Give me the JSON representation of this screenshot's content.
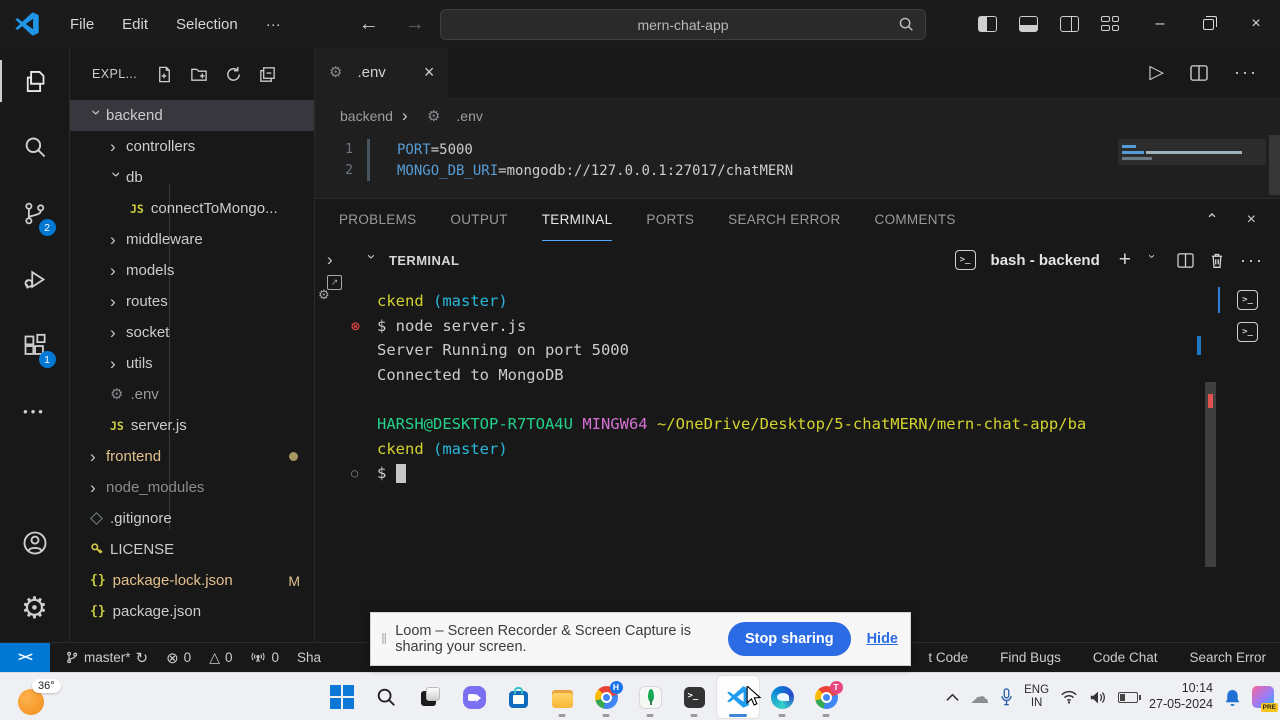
{
  "colors": {
    "accent": "#0078d4",
    "modified": "#e2c08d",
    "ignored": "#8c8c8c",
    "error_red": "#f14c4c"
  },
  "titlebar": {
    "menus": [
      "File",
      "Edit",
      "Selection",
      "···"
    ],
    "search": "mern-chat-app"
  },
  "activitybar": {
    "scm_badge": "2",
    "extensions_badge": "1"
  },
  "sidebar": {
    "header": "EXPL...",
    "tree": [
      {
        "label": "backend",
        "level": 0,
        "chevron": "down",
        "selected": true
      },
      {
        "label": "controllers",
        "level": 1,
        "chevron": "right"
      },
      {
        "label": "db",
        "level": 1,
        "chevron": "down"
      },
      {
        "label": "connectToMongo...",
        "level": 2,
        "icon": "js"
      },
      {
        "label": "middleware",
        "level": 1,
        "chevron": "right"
      },
      {
        "label": "models",
        "level": 1,
        "chevron": "right"
      },
      {
        "label": "routes",
        "level": 1,
        "chevron": "right"
      },
      {
        "label": "socket",
        "level": 1,
        "chevron": "right"
      },
      {
        "label": "utils",
        "level": 1,
        "chevron": "right"
      },
      {
        "label": ".env",
        "level": 1,
        "icon": "gear",
        "color": "#9b9b9b"
      },
      {
        "label": "server.js",
        "level": 1,
        "icon": "js"
      },
      {
        "label": "frontend",
        "level": 0,
        "chevron": "right",
        "color": "#e2c08d",
        "dot": true
      },
      {
        "label": "node_modules",
        "level": 0,
        "chevron": "right",
        "color": "#8c8c8c"
      },
      {
        "label": ".gitignore",
        "level": 0,
        "icon": "git"
      },
      {
        "label": "LICENSE",
        "level": 0,
        "icon": "key"
      },
      {
        "label": "package-lock.json",
        "level": 0,
        "icon": "braces",
        "color": "#e2c08d",
        "badge": "M"
      },
      {
        "label": "package.json",
        "level": 0,
        "icon": "braces"
      }
    ]
  },
  "editor": {
    "tab": ".env",
    "breadcrumb": [
      "backend",
      ".env"
    ],
    "lines": [
      {
        "num": "1",
        "segments": [
          {
            "text": "PORT",
            "color": "#569cd6"
          },
          {
            "text": "=5000",
            "color": "#cccccc"
          }
        ]
      },
      {
        "num": "2",
        "segments": [
          {
            "text": "MONGO_DB_URI",
            "color": "#569cd6"
          },
          {
            "text": "=mongodb://127.0.0.1:27017/chatMERN",
            "color": "#cccccc"
          }
        ]
      }
    ]
  },
  "panel": {
    "tabs": [
      {
        "label": "PROBLEMS"
      },
      {
        "label": "OUTPUT"
      },
      {
        "label": "TERMINAL",
        "active": true
      },
      {
        "label": "PORTS"
      },
      {
        "label": "SEARCH ERROR"
      },
      {
        "label": "COMMENTS"
      }
    ],
    "view_title": "TERMINAL",
    "shell_label": "bash - backend"
  },
  "terminal": {
    "lines": [
      {
        "segments": [
          {
            "text": "ckend ",
            "color": "#d3d32e"
          },
          {
            "text": "(master)",
            "color": "#29b8db"
          }
        ]
      },
      {
        "gutter": "error",
        "segments": [
          {
            "text": "$ node server.js",
            "color": "#cccccc"
          }
        ]
      },
      {
        "segments": [
          {
            "text": "Server Running on port 5000",
            "color": "#cccccc"
          }
        ]
      },
      {
        "segments": [
          {
            "text": "Connected to MongoDB",
            "color": "#cccccc"
          }
        ]
      },
      {
        "segments": []
      },
      {
        "segments": [
          {
            "text": "HARSH@DESKTOP-R7TOA4U ",
            "color": "#23d18b"
          },
          {
            "text": "MINGW64 ",
            "color": "#d670d6"
          },
          {
            "text": "~/OneDrive/Desktop/5-chatMERN/mern-chat-app/ba",
            "color": "#d3d32e"
          }
        ]
      },
      {
        "segments": [
          {
            "text": "ckend ",
            "color": "#d3d32e"
          },
          {
            "text": "(master)",
            "color": "#29b8db"
          }
        ]
      },
      {
        "gutter": "circle",
        "cursor": true,
        "segments": [
          {
            "text": "$ ",
            "color": "#cccccc"
          }
        ]
      }
    ]
  },
  "statusbar": {
    "left": [
      {
        "name": "branch",
        "label": "master*"
      },
      {
        "name": "errors",
        "label": "0"
      },
      {
        "name": "warnings",
        "label": "0"
      },
      {
        "name": "radio",
        "label": "0"
      },
      {
        "name": "share-fragment",
        "label": "Sha"
      }
    ],
    "right": [
      {
        "label": "t Code"
      },
      {
        "label": "Find Bugs"
      },
      {
        "label": "Code Chat"
      },
      {
        "label": "Search Error"
      }
    ]
  },
  "loom": {
    "message": "Loom – Screen Recorder & Screen Capture is sharing your screen.",
    "button": "Stop sharing",
    "hide": "Hide"
  },
  "taskbar": {
    "weather": "36°",
    "apps": [
      {
        "name": "start"
      },
      {
        "name": "search"
      },
      {
        "name": "task-view"
      },
      {
        "name": "chat"
      },
      {
        "name": "store"
      },
      {
        "name": "file-explorer",
        "running": true
      },
      {
        "name": "chrome-profile-h",
        "running": true,
        "badge": "H",
        "badge_color": "#1a73e8"
      },
      {
        "name": "mongodb-compass",
        "running": true
      },
      {
        "name": "terminal",
        "running": true
      },
      {
        "name": "vscode",
        "running": true,
        "active": true
      },
      {
        "name": "edge",
        "running": true
      },
      {
        "name": "chrome-profile-t",
        "running": true,
        "badge": "T",
        "badge_color": "#e8457c"
      }
    ],
    "tray": {
      "lang_line1": "ENG",
      "lang_line2": "IN",
      "time": "10:14",
      "date": "27-05-2024",
      "copilot_badge": "PRE"
    }
  }
}
